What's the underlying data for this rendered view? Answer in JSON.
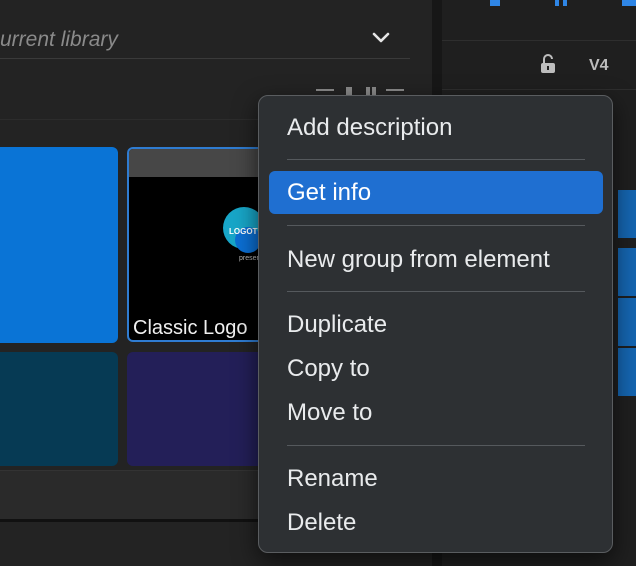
{
  "library": {
    "search_text": "urrent library",
    "thumbnail_caption": "Classic Logo",
    "logo_text": "LOGOTY",
    "logo_sub": "presen"
  },
  "timeline": {
    "track_label": "V4"
  },
  "context_menu": {
    "items": [
      {
        "label": "Add description"
      },
      {
        "label": "Get info",
        "highlighted": true
      },
      {
        "label": "New group from element"
      },
      {
        "label": "Duplicate"
      },
      {
        "label": "Copy to"
      },
      {
        "label": "Move to"
      },
      {
        "label": "Rename"
      },
      {
        "label": "Delete"
      }
    ]
  },
  "colors": {
    "highlight": "#1f6fd1",
    "menu_bg": "#2d3033",
    "accent_blue": "#0a74d6"
  }
}
